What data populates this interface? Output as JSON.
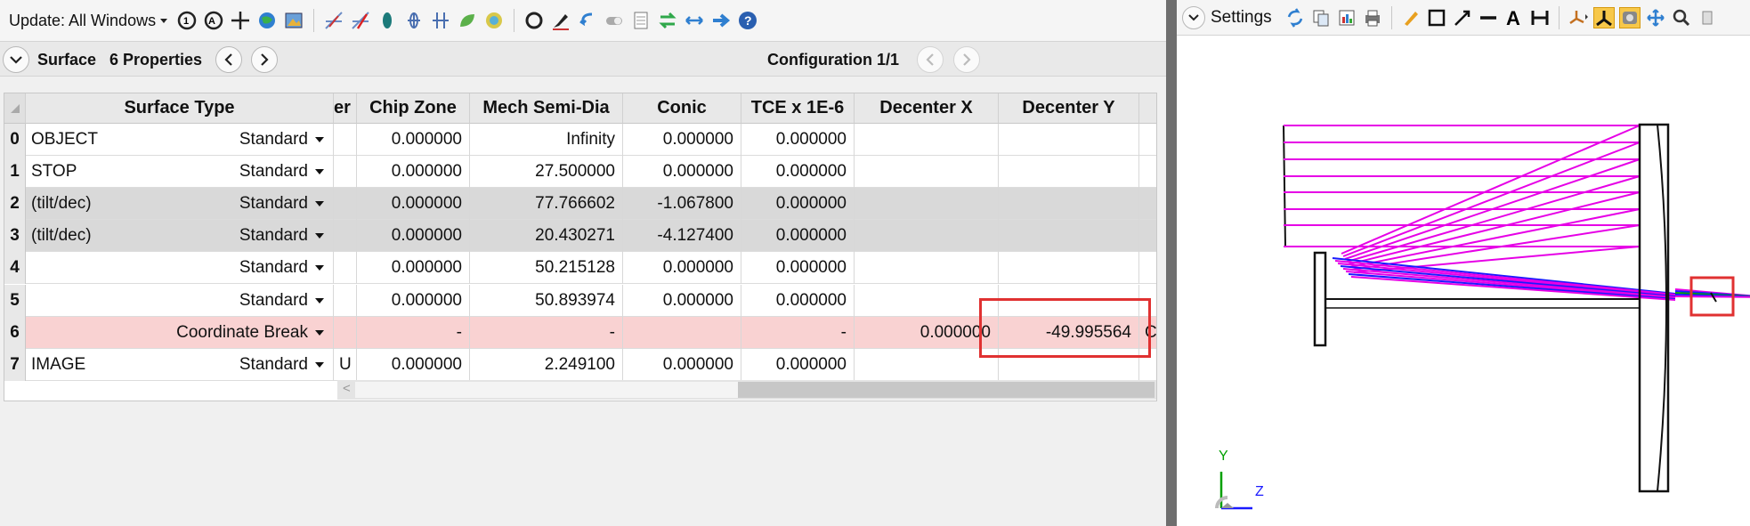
{
  "toolbar": {
    "update_label": "Update: All Windows"
  },
  "surface_bar": {
    "surface_label": "Surface",
    "properties_label": "6 Properties",
    "configuration_label": "Configuration 1/1"
  },
  "table": {
    "headers": {
      "surface_type": "Surface Type",
      "partial": "er",
      "chip_zone": "Chip Zone",
      "mech_semi_dia": "Mech Semi-Dia",
      "conic": "Conic",
      "tce": "TCE x 1E-6",
      "decenter_x": "Decenter X",
      "decenter_y": "Decenter Y"
    },
    "rows": [
      {
        "num": "0",
        "comment": "OBJECT",
        "type": "Standard",
        "partial": "",
        "chip_zone": "0.000000",
        "mech_semi_dia": "Infinity",
        "conic": "0.000000",
        "tce": "0.000000",
        "decenter_x": "",
        "decenter_y": "",
        "extra": ""
      },
      {
        "num": "1",
        "comment": "STOP",
        "type": "Standard",
        "partial": "",
        "chip_zone": "0.000000",
        "mech_semi_dia": "27.500000",
        "conic": "0.000000",
        "tce": "0.000000",
        "decenter_x": "",
        "decenter_y": "",
        "extra": ""
      },
      {
        "num": "2",
        "comment": "(tilt/dec)",
        "type": "Standard",
        "partial": "",
        "chip_zone": "0.000000",
        "mech_semi_dia": "77.766602",
        "conic": "-1.067800",
        "tce": "0.000000",
        "decenter_x": "",
        "decenter_y": "",
        "extra": ""
      },
      {
        "num": "3",
        "comment": "(tilt/dec)",
        "type": "Standard",
        "partial": "",
        "chip_zone": "0.000000",
        "mech_semi_dia": "20.430271",
        "conic": "-4.127400",
        "tce": "0.000000",
        "decenter_x": "",
        "decenter_y": "",
        "extra": ""
      },
      {
        "num": "4",
        "comment": "",
        "type": "Standard",
        "partial": "",
        "chip_zone": "0.000000",
        "mech_semi_dia": "50.215128",
        "conic": "0.000000",
        "tce": "0.000000",
        "decenter_x": "",
        "decenter_y": "",
        "extra": ""
      },
      {
        "num": "5",
        "comment": "",
        "type": "Standard",
        "partial": "",
        "chip_zone": "0.000000",
        "mech_semi_dia": "50.893974",
        "conic": "0.000000",
        "tce": "0.000000",
        "decenter_x": "",
        "decenter_y": "",
        "extra": ""
      },
      {
        "num": "6",
        "comment": "",
        "type": "Coordinate Break",
        "partial": "",
        "chip_zone": "-",
        "mech_semi_dia": "-",
        "conic": "",
        "tce": "-",
        "decenter_x": "0.000000",
        "decenter_y": "-49.995564",
        "extra": "C"
      },
      {
        "num": "7",
        "comment": "IMAGE",
        "type": "Standard",
        "partial": "U",
        "chip_zone": "0.000000",
        "mech_semi_dia": "2.249100",
        "conic": "0.000000",
        "tce": "0.000000",
        "decenter_x": "",
        "decenter_y": "",
        "extra": ""
      }
    ]
  },
  "right_panel": {
    "settings_label": "Settings",
    "axis_y_label": "Y",
    "axis_z_label": "Z"
  },
  "colors": {
    "ray_magenta": "#e600e6",
    "ray_blue": "#1a1aff",
    "ray_green": "#00a000",
    "highlight_red": "#e03131",
    "coord_break_row": "#f9d2d2",
    "tilt_row": "#d9d9d9"
  }
}
